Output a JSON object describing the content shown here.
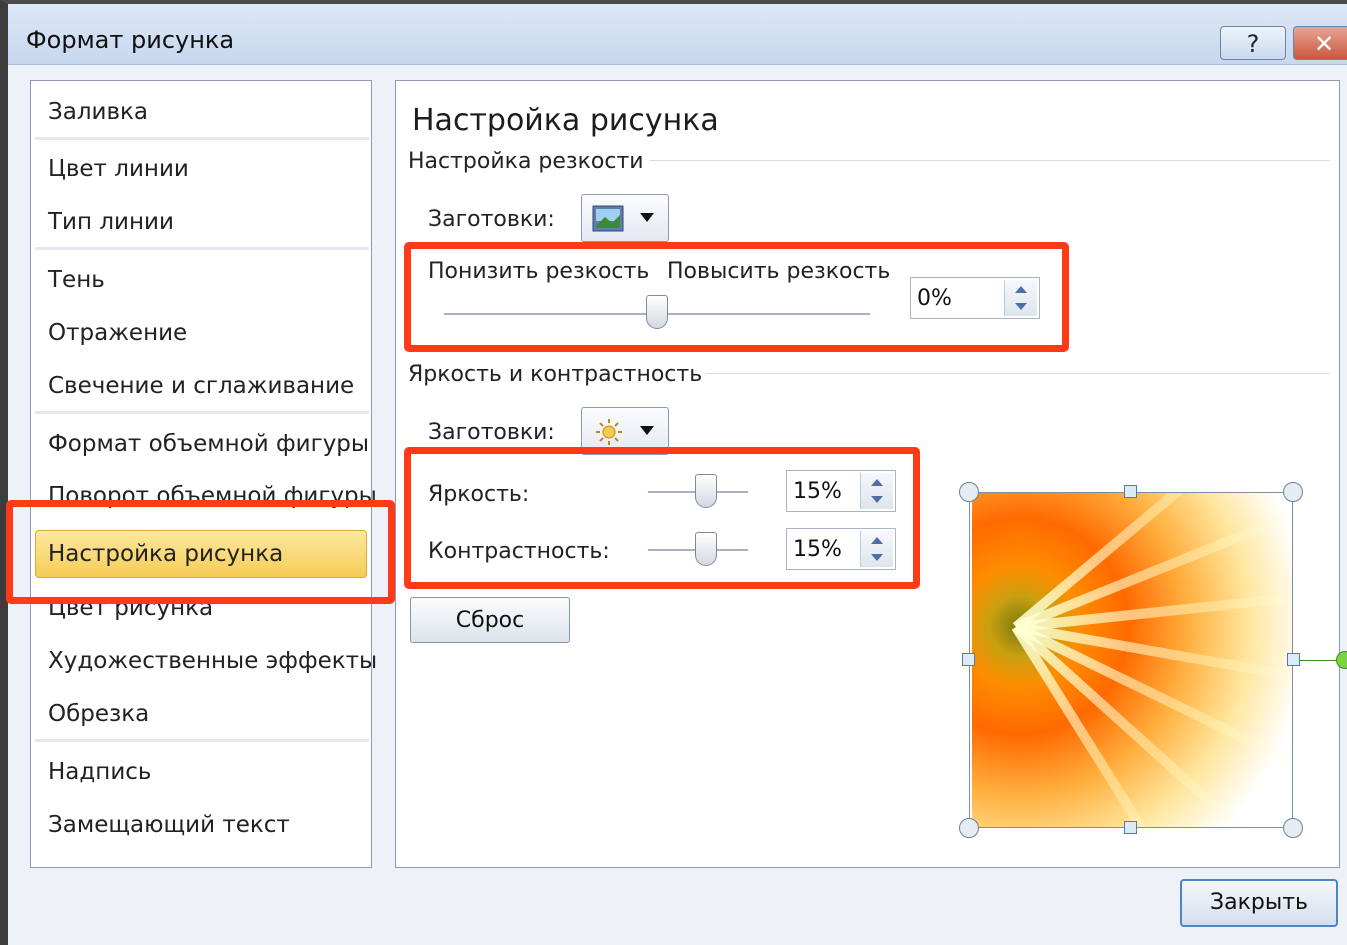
{
  "window": {
    "title": "Формат рисунка",
    "help_label": "?",
    "close_label": "✕"
  },
  "sidebar": {
    "items": [
      {
        "label": "Заливка"
      },
      {
        "label": "Цвет линии"
      },
      {
        "label": "Тип линии"
      },
      {
        "label": "Тень"
      },
      {
        "label": "Отражение"
      },
      {
        "label": "Свечение и сглаживание"
      },
      {
        "label": "Формат объемной фигуры"
      },
      {
        "label": "Поворот объемной фигуры"
      },
      {
        "label": "Настройка рисунка"
      },
      {
        "label": "Цвет рисунка"
      },
      {
        "label": "Художественные эффекты"
      },
      {
        "label": "Обрезка"
      },
      {
        "label": "Надпись"
      },
      {
        "label": "Замещающий текст"
      }
    ]
  },
  "panel": {
    "title": "Настройка рисунка",
    "sharpness": {
      "section_label": "Настройка резкости",
      "presets_label": "Заготовки:",
      "preset_icon": "picture-preset-icon",
      "soften_label": "Понизить резкость",
      "sharpen_label": "Повысить резкость",
      "value": "0%",
      "level": 0.5
    },
    "brightness_contrast": {
      "section_label": "Яркость и контрастность",
      "presets_label": "Заготовки:",
      "preset_icon": "sun-icon",
      "brightness_label": "Яркость:",
      "brightness_value": "15%",
      "brightness_level": 0.575,
      "contrast_label": "Контрастность:",
      "contrast_value": "15%",
      "contrast_level": 0.575
    },
    "reset_label": "Сброс"
  },
  "footer": {
    "close_label": "Закрыть"
  },
  "colors": {
    "highlight": "#ff3b17",
    "selected": "#f6cc55",
    "accent": "#4d86c6"
  }
}
